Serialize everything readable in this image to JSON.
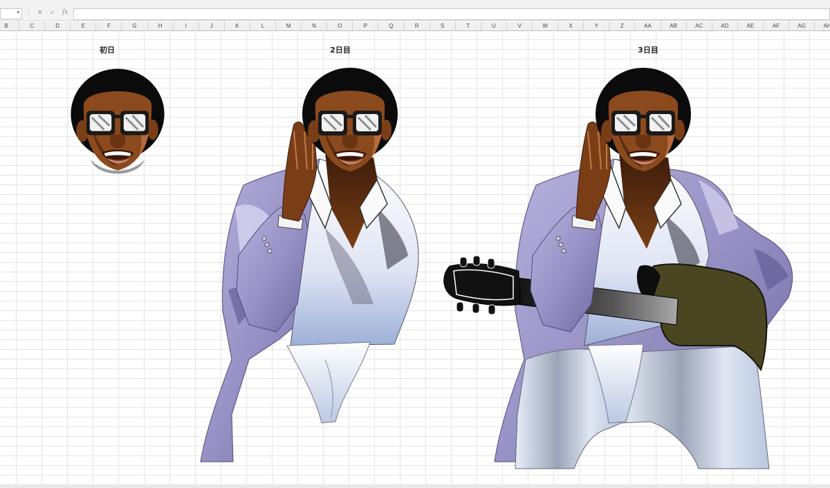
{
  "formula_bar": {
    "name_box_value": "",
    "cancel_icon": "close-icon",
    "enter_icon": "check-icon",
    "fx_label": "fx",
    "formula_value": ""
  },
  "columns": [
    "B",
    "C",
    "D",
    "E",
    "F",
    "G",
    "H",
    "I",
    "J",
    "K",
    "L",
    "M",
    "N",
    "O",
    "P",
    "Q",
    "R",
    "S",
    "T",
    "U",
    "V",
    "W",
    "X",
    "Y",
    "Z",
    "AA",
    "AB",
    "AC",
    "AD",
    "AE",
    "AF",
    "AG",
    "AH"
  ],
  "titles": {
    "day1": "初日",
    "day2": "2日目",
    "day3": "3日目"
  },
  "colors": {
    "skin": "#8a4a1e",
    "hair": "#0b0b0b",
    "jacket": "#9d97c9",
    "shirt": "#e4e8f4",
    "guitar_body": "#4a4622",
    "pants": "#c8d4ea"
  }
}
